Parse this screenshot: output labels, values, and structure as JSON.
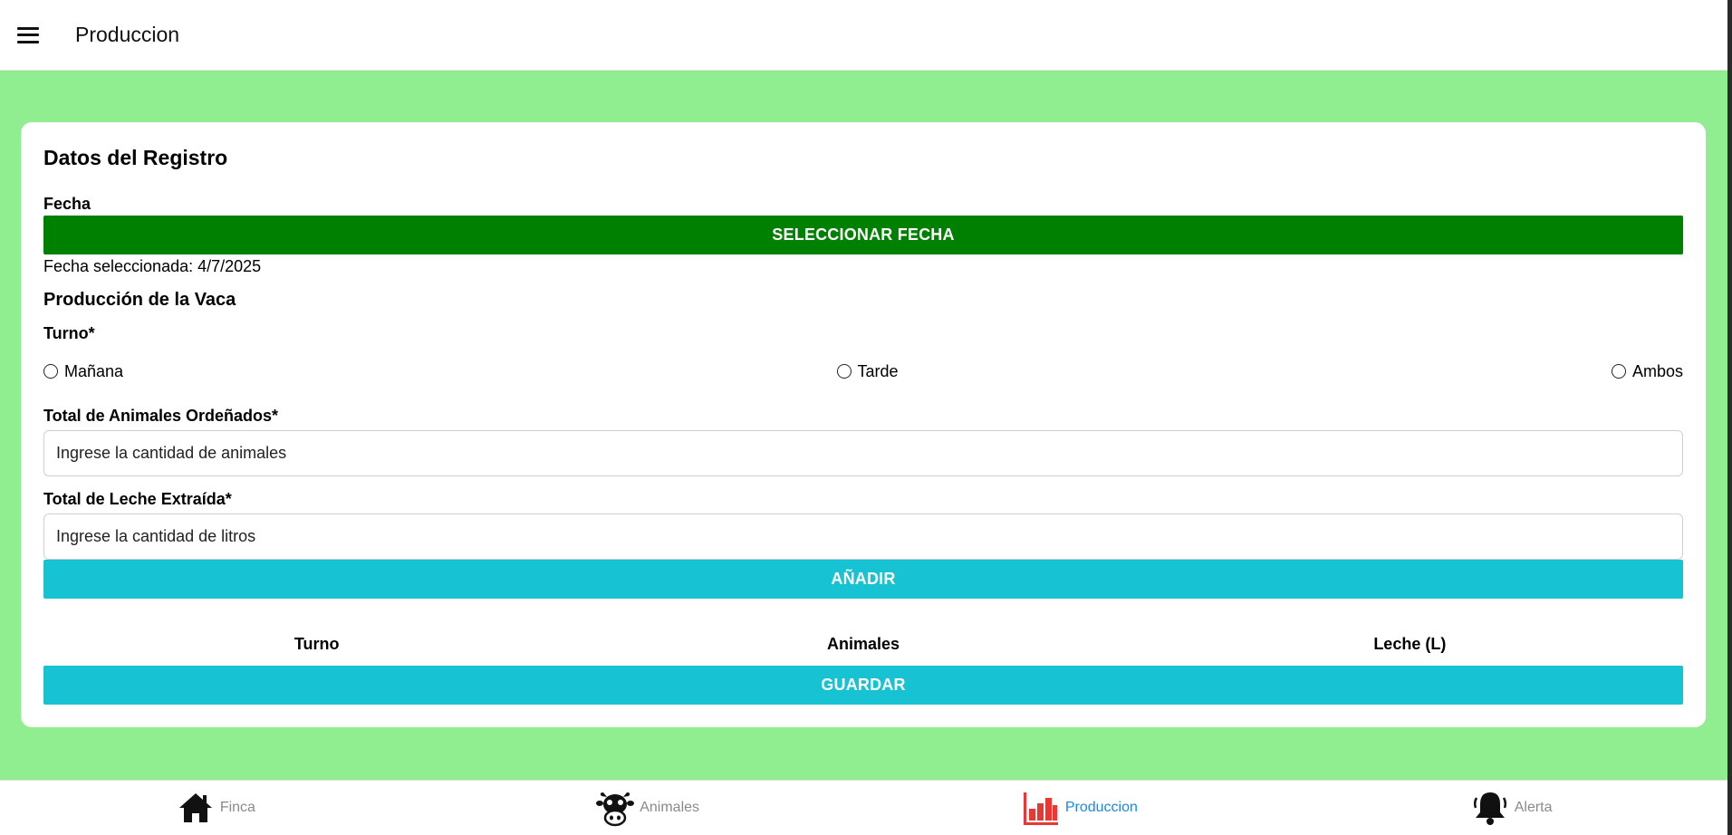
{
  "appbar": {
    "title": "Produccion",
    "menu_icon": "menu-icon"
  },
  "card": {
    "title": "Datos del Registro",
    "fecha_label": "Fecha",
    "select_date_button": "SELECCIONAR FECHA",
    "selected_date_text": "Fecha seleccionada: 4/7/2025",
    "section_title": "Producción de la Vaca",
    "turno_label": "Turno*",
    "turno_options": [
      "Mañana",
      "Tarde",
      "Ambos"
    ],
    "animales_label": "Total de Animales Ordeñados*",
    "animales_placeholder": "Ingrese la cantidad de animales",
    "leche_label": "Total de Leche Extraída*",
    "leche_placeholder": "Ingrese la cantidad de litros",
    "add_button": "AÑADIR",
    "table_headers": [
      "Turno",
      "Animales",
      "Leche (L)"
    ],
    "save_button": "GUARDAR"
  },
  "bottom_nav": {
    "items": [
      {
        "label": "Finca",
        "icon": "house-icon"
      },
      {
        "label": "Animales",
        "icon": "cow-icon"
      },
      {
        "label": "Produccion",
        "icon": "bar-chart-icon",
        "active": true
      },
      {
        "label": "Alerta",
        "icon": "bell-icon"
      }
    ]
  },
  "colors": {
    "background": "#90ee90",
    "primary_green": "#008000",
    "accent_teal": "#17c2d3",
    "active_nav": "#1e88e5",
    "chart_icon_red": "#e53935"
  }
}
